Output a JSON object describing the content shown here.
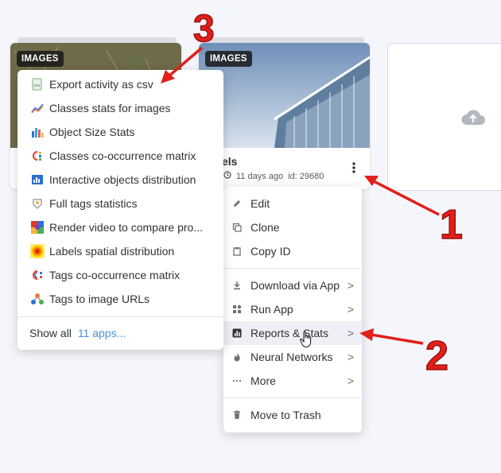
{
  "cards": [
    {
      "badge": "IMAGES"
    },
    {
      "badge": "IMAGES",
      "title": "els",
      "time": "11 days ago",
      "id_text": "id: 29680"
    }
  ],
  "context_menu": {
    "items": [
      {
        "label": "Edit",
        "icon": "pencil-icon"
      },
      {
        "label": "Clone",
        "icon": "copy-icon"
      },
      {
        "label": "Copy ID",
        "icon": "clipboard-icon"
      },
      {
        "label": "Download via App",
        "icon": "download-icon",
        "submenu": true
      },
      {
        "label": "Run App",
        "icon": "apps-grid-icon",
        "submenu": true
      },
      {
        "label": "Reports & Stats",
        "icon": "bar-chart-icon",
        "submenu": true,
        "active": true
      },
      {
        "label": "Neural Networks",
        "icon": "flame-icon",
        "submenu": true
      },
      {
        "label": "More",
        "icon": "ellipsis-icon",
        "submenu": true
      },
      {
        "label": "Move to Trash",
        "icon": "trash-icon"
      }
    ],
    "chevron": ">"
  },
  "submenu": {
    "items": [
      {
        "label": "Export activity as csv",
        "icon": "csv-file-icon"
      },
      {
        "label": "Classes stats for images",
        "icon": "line-chart-icon"
      },
      {
        "label": "Object Size Stats",
        "icon": "bar-chart-color-icon"
      },
      {
        "label": "Classes co-occurrence matrix",
        "icon": "matrix-icon"
      },
      {
        "label": "Interactive objects distribution",
        "icon": "distribution-icon"
      },
      {
        "label": "Full tags statistics",
        "icon": "tag-badge-icon"
      },
      {
        "label": "Render video to compare pro...",
        "icon": "video-grid-icon"
      },
      {
        "label": "Labels spatial distribution",
        "icon": "heatmap-icon"
      },
      {
        "label": "Tags co-occurrence matrix",
        "icon": "tags-matrix-icon"
      },
      {
        "label": "Tags to image URLs",
        "icon": "graph-nodes-icon"
      }
    ],
    "show_all_label": "Show all",
    "show_all_link": "11 apps..."
  },
  "annotations": [
    "1",
    "2",
    "3"
  ],
  "colors": {
    "accent": "#4a90e2",
    "arrow": "#e0201a",
    "active_bg": "#eef0f5"
  }
}
